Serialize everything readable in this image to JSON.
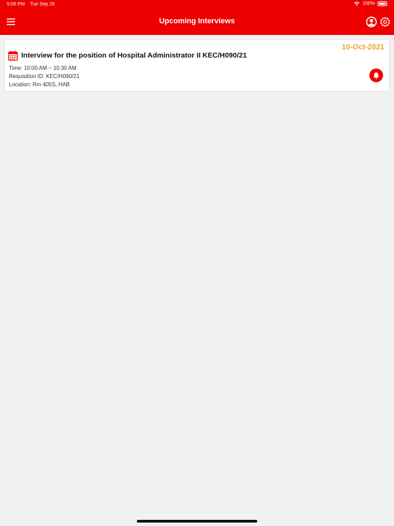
{
  "status_bar": {
    "time": "5:06 PM",
    "date": "Tue Sep 28",
    "battery": "100%"
  },
  "header": {
    "title": "Upcoming Interviews"
  },
  "interviews": [
    {
      "date": "10-Oct-2021",
      "title": "Interview for the position of Hospital Administrator II KEC/H090/21",
      "time": "Time: 10:00 AM ~ 10:30 AM",
      "requisition": "Requisition ID: KEC/H090/21",
      "location": "Location: Rm 405S, HAB"
    }
  ],
  "colors": {
    "brand": "#ee0000",
    "date": "#f2a22a",
    "background": "#f1f1f1"
  },
  "icons": [
    "menu-icon",
    "profile-icon",
    "settings-icon",
    "calendar-icon",
    "bell-icon",
    "wifi-icon",
    "battery-icon"
  ]
}
